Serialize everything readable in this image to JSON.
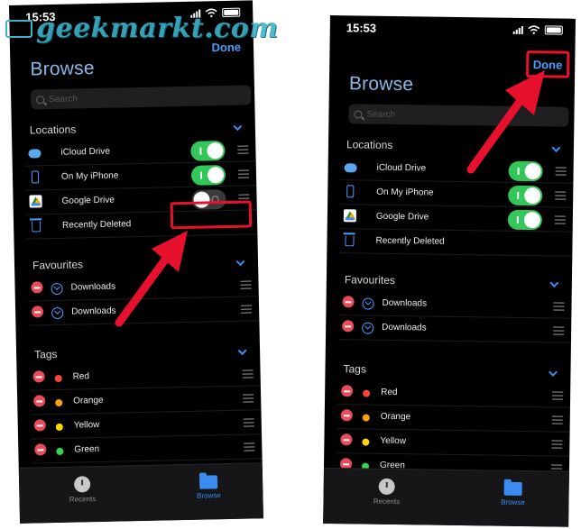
{
  "watermark": "geekmarkt.com",
  "colors": {
    "accent": "#3b8cf0",
    "toggle_on": "#33c659",
    "highlight": "#e8112d",
    "remove": "#e84b5a"
  },
  "left": {
    "status_time": "15:53",
    "done_label": "Done",
    "title": "Browse",
    "search_placeholder": "Search",
    "locations_title": "Locations",
    "locations": [
      {
        "label": "iCloud Drive",
        "icon": "cloud-icon",
        "enabled": true
      },
      {
        "label": "On My iPhone",
        "icon": "iphone-icon",
        "enabled": true
      },
      {
        "label": "Google Drive",
        "icon": "google-drive-icon",
        "enabled": false
      },
      {
        "label": "Recently Deleted",
        "icon": "trash-icon"
      }
    ],
    "favourites_title": "Favourites",
    "favourites": [
      {
        "label": "Downloads"
      },
      {
        "label": "Downloads"
      }
    ],
    "tags_title": "Tags",
    "tags": [
      {
        "label": "Red",
        "color": "#ff453a"
      },
      {
        "label": "Orange",
        "color": "#ff9f0a"
      },
      {
        "label": "Yellow",
        "color": "#ffd60a"
      },
      {
        "label": "Green",
        "color": "#32d74b"
      }
    ],
    "tab_recents": "Recents",
    "tab_browse": "Browse"
  },
  "right": {
    "status_time": "15:53",
    "done_label": "Done",
    "title": "Browse",
    "search_placeholder": "Search",
    "locations_title": "Locations",
    "locations": [
      {
        "label": "iCloud Drive",
        "icon": "cloud-icon",
        "enabled": true
      },
      {
        "label": "On My iPhone",
        "icon": "iphone-icon",
        "enabled": true
      },
      {
        "label": "Google Drive",
        "icon": "google-drive-icon",
        "enabled": true
      },
      {
        "label": "Recently Deleted",
        "icon": "trash-icon"
      }
    ],
    "favourites_title": "Favourites",
    "favourites": [
      {
        "label": "Downloads"
      },
      {
        "label": "Downloads"
      }
    ],
    "tags_title": "Tags",
    "tags": [
      {
        "label": "Red",
        "color": "#ff453a"
      },
      {
        "label": "Orange",
        "color": "#ff9f0a"
      },
      {
        "label": "Yellow",
        "color": "#ffd60a"
      },
      {
        "label": "Green",
        "color": "#32d74b"
      }
    ],
    "tab_recents": "Recents",
    "tab_browse": "Browse"
  }
}
